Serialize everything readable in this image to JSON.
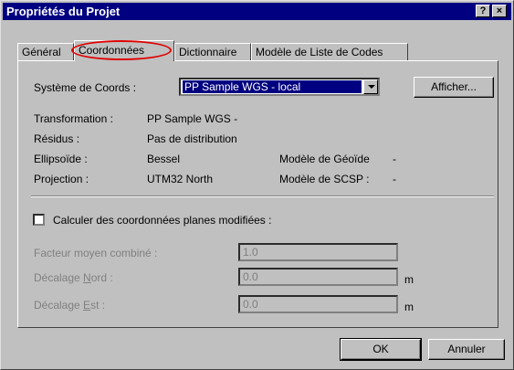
{
  "window": {
    "title": "Propriétés du Projet",
    "help_label": "?",
    "close_label": "×"
  },
  "tabs": [
    {
      "label": "Général",
      "active": false
    },
    {
      "label": "Coordonnées",
      "active": true
    },
    {
      "label": "Dictionnaire",
      "active": false
    },
    {
      "label": "Modèle de Liste de Codes",
      "active": false
    }
  ],
  "coord_system": {
    "label": "Système de Coords :",
    "value": "PP Sample WGS - local",
    "button": "Afficher..."
  },
  "info": {
    "transformation_label": "Transformation :",
    "transformation_value": "PP Sample WGS -",
    "residus_label": "Résidus :",
    "residus_value": "Pas de distribution",
    "ellipsoide_label": "Ellipsoïde :",
    "ellipsoide_value": "Bessel",
    "geoide_label": "Modèle de Géoïde",
    "geoide_value": "-",
    "projection_label": "Projection :",
    "projection_value": "UTM32 North",
    "scsp_label": "Modèle de SCSP :",
    "scsp_value": "-"
  },
  "planes": {
    "checkbox_label": "Calculer des coordonnées planes modifiées :",
    "checked": false,
    "facteur_label": "Facteur moyen combiné :",
    "facteur_value": "1.0",
    "nord_label_pre": "Décalage ",
    "nord_label_u": "N",
    "nord_label_post": "ord :",
    "nord_value": "0.0",
    "nord_unit": "m",
    "est_label_pre": "Décalage ",
    "est_label_u": "E",
    "est_label_post": "st :",
    "est_value": "0.0",
    "est_unit": "m"
  },
  "footer": {
    "ok": "OK",
    "cancel": "Annuler"
  },
  "colors": {
    "titlebar": "#000080",
    "face": "#c0c0c0",
    "highlight_ring": "#e00000"
  }
}
